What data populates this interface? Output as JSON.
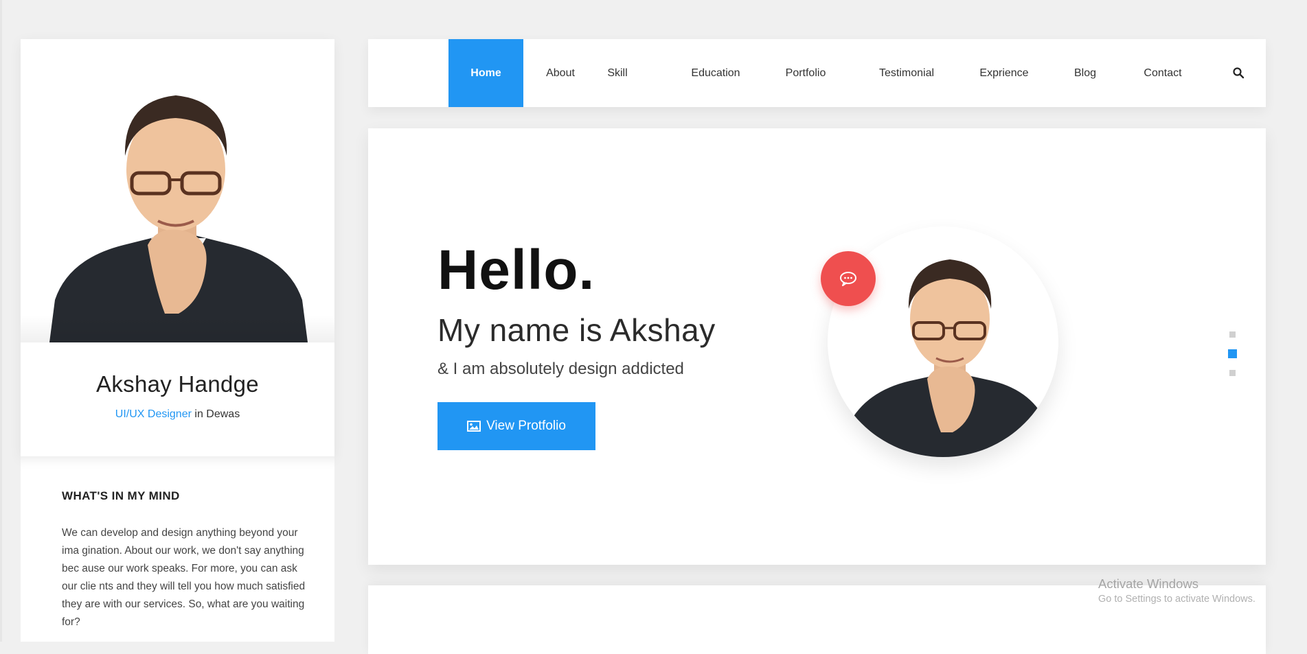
{
  "profile": {
    "name": "Akshay Handge",
    "role": "UI/UX Designer",
    "location_text": "in Dewas"
  },
  "mind": {
    "title": "WHAT'S IN MY MIND",
    "text": "We can develop and design anything beyond your ima gination. About our work, we don't say anything bec ause our work speaks. For more, you can ask our clie nts and they will tell you how much satisfied they are with our services. So, what are you waiting for?"
  },
  "nav": {
    "items": [
      "Home",
      "About",
      "Skill",
      "Education",
      "Portfolio",
      "Testimonial",
      "Exprience",
      "Blog",
      "Contact"
    ],
    "active": "Home",
    "search_icon": "search-icon"
  },
  "hero": {
    "greeting": "Hello.",
    "name_line": "My name is Akshay",
    "tagline": "& I am absolutely design addicted",
    "button_label": "View Protfolio",
    "button_icon": "image-icon",
    "chat_icon": "chat-icon"
  },
  "slider": {
    "dots": 3,
    "active_index": 1
  },
  "colors": {
    "accent": "#2196f3",
    "chat": "#ef4f4f",
    "background": "#f0f0f0"
  },
  "system": {
    "activate_title": "Activate Windows",
    "activate_sub": "Go to Settings to activate Windows."
  }
}
